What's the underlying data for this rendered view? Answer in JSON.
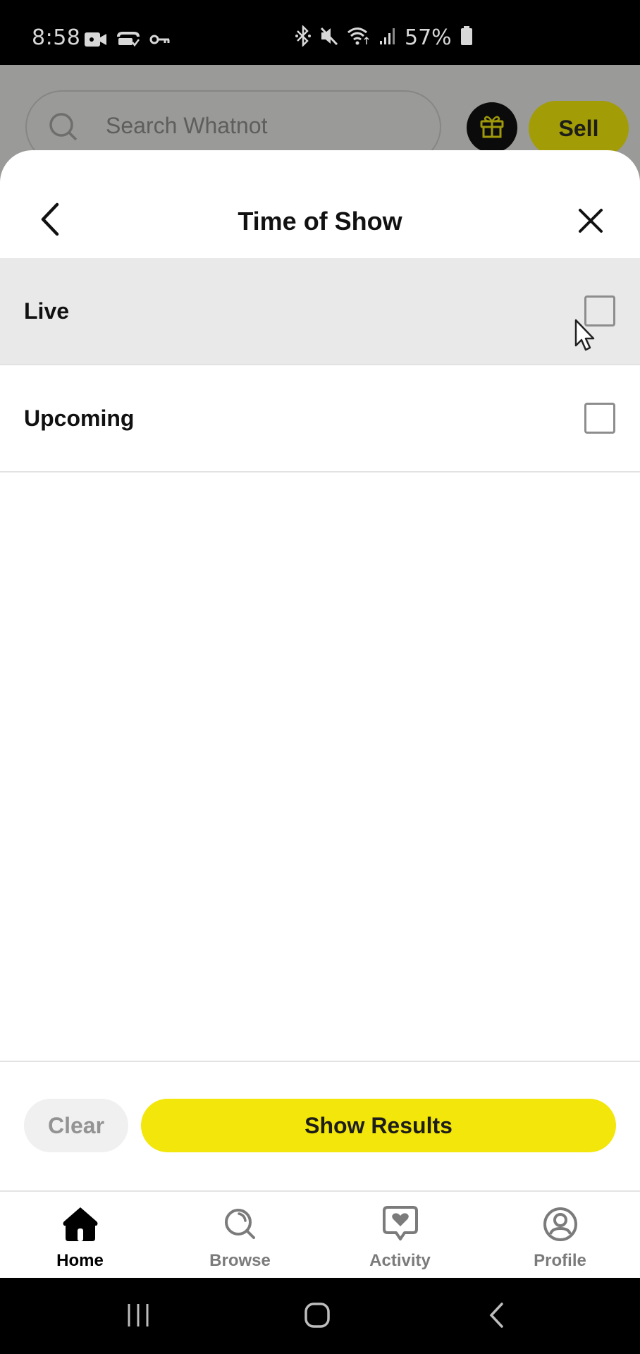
{
  "status_bar": {
    "time": "8:58",
    "left_icons": [
      "video-camera-icon",
      "cast-check-icon",
      "vpn-key-icon"
    ],
    "right_icons": [
      "bluetooth-icon",
      "mute-icon",
      "wifi-icon",
      "signal-icon"
    ],
    "battery_percent": "57%"
  },
  "background_header": {
    "search_placeholder": "Search Whatnot",
    "gift_icon": "gift-icon",
    "sell_label": "Sell"
  },
  "sheet": {
    "title": "Time of Show",
    "back_icon": "chevron-left-icon",
    "close_icon": "close-icon",
    "options": [
      {
        "label": "Live",
        "checked": false
      },
      {
        "label": "Upcoming",
        "checked": false
      }
    ],
    "clear_label": "Clear",
    "show_results_label": "Show Results"
  },
  "tabbar": {
    "tabs": [
      {
        "label": "Home",
        "icon": "home-icon",
        "active": true
      },
      {
        "label": "Browse",
        "icon": "browse-search-icon",
        "active": false
      },
      {
        "label": "Activity",
        "icon": "activity-heart-icon",
        "active": false
      },
      {
        "label": "Profile",
        "icon": "profile-icon",
        "active": false
      }
    ]
  },
  "system_nav": {
    "buttons": [
      "recent-apps-icon",
      "home-nav-icon",
      "back-nav-icon"
    ]
  },
  "colors": {
    "accent_yellow": "#f3e60a",
    "dimmed_yellow": "#a29c06",
    "hover_row": "#e9e9e9"
  }
}
